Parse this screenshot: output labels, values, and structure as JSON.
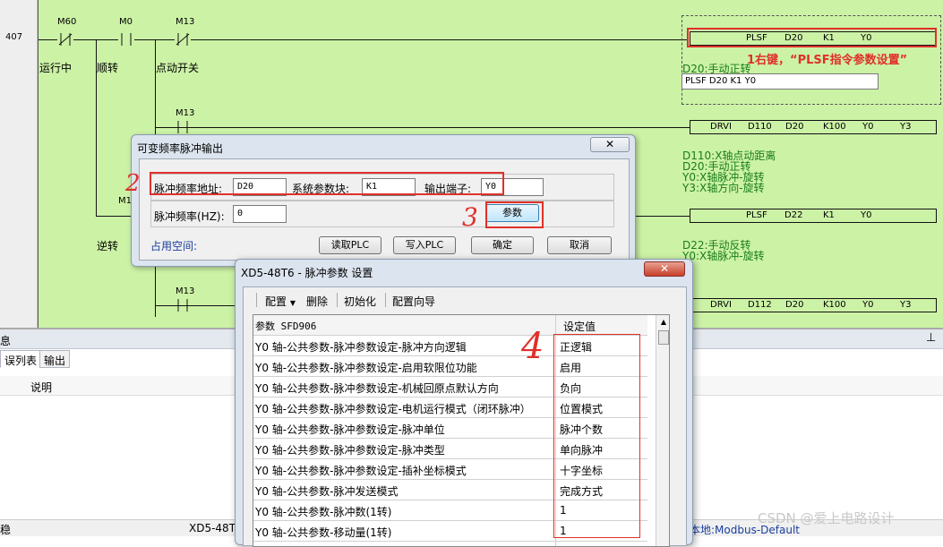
{
  "ladder": {
    "rung_number": "407",
    "contacts": {
      "m60": "M60",
      "m0": "M0",
      "m13_top": "M13",
      "m13_mid": "M13",
      "m1": "M1",
      "m13_bottom": "M13"
    },
    "labels": {
      "running": "运行中",
      "forward": "顺转",
      "jog_switch": "点动开关",
      "reverse": "逆转"
    },
    "instructions": {
      "plsf1": [
        "PLSF",
        "D20",
        "K1",
        "Y0"
      ],
      "drvi1": [
        "DRVI",
        "D110",
        "D20",
        "K100",
        "Y0",
        "Y3"
      ],
      "plsf2": [
        "PLSF",
        "D22",
        "K1",
        "Y0"
      ],
      "drvi2": [
        "DRVI",
        "D112",
        "D20",
        "K100",
        "Y0",
        "Y3"
      ]
    },
    "comments": {
      "c1": "D20:手动正转",
      "c2_l1": "D110:X轴点动距离",
      "c2_l2": "D20:手动正转",
      "c2_l3": "Y0:X轴脉冲-旋转",
      "c2_l4": "Y3:X轴方向-旋转",
      "c3_l1": "D22:手动反转",
      "c3_l2": "Y0:X轴脉冲-旋转"
    },
    "edit_field_value": "PLSF D20 K1 Y0"
  },
  "annotations": {
    "a1": "1右键，“PLSF指令参数设置”",
    "a2": "2",
    "a3": "3",
    "a4": "4"
  },
  "bottom_panel": {
    "title_fragment": "息",
    "pin_icon": "pin-icon",
    "tabs": [
      "误列表",
      "输出"
    ],
    "column_header": "说明",
    "status_left": "稳",
    "status_mid": "XD5-48T",
    "status_right": "本地:Modbus-Default"
  },
  "dialog1": {
    "title": "可变频率脉冲输出",
    "close_glyph": "✕",
    "freq_addr_label": "脉冲频率地址:",
    "freq_addr_value": "D20",
    "sys_param_label": "系统参数块:",
    "sys_param_value": "K1",
    "output_label": "输出端子:",
    "output_value": "Y0",
    "freq_label": "脉冲频率(HZ):",
    "freq_value": "0",
    "param_button": "参数",
    "occupied_label": "占用空间:",
    "read_plc": "读取PLC",
    "write_plc": "写入PLC",
    "ok": "确定",
    "cancel": "取消"
  },
  "dialog2": {
    "title": "XD5-48T6 - 脉冲参数 设置",
    "close_glyph": "✕",
    "toolbar": {
      "config": "配置",
      "delete": "删除",
      "init": "初始化",
      "wizard": "配置向导"
    },
    "header": {
      "param": "参数 SFD906",
      "value": "设定值"
    },
    "rows": [
      {
        "name": "Y0 轴-公共参数-脉冲参数设定-脉冲方向逻辑",
        "value": "正逻辑"
      },
      {
        "name": "Y0 轴-公共参数-脉冲参数设定-启用软限位功能",
        "value": "启用"
      },
      {
        "name": "Y0 轴-公共参数-脉冲参数设定-机械回原点默认方向",
        "value": "负向"
      },
      {
        "name": "Y0 轴-公共参数-脉冲参数设定-电机运行模式（闭环脉冲）",
        "value": "位置模式"
      },
      {
        "name": "Y0 轴-公共参数-脉冲参数设定-脉冲单位",
        "value": "脉冲个数"
      },
      {
        "name": "Y0 轴-公共参数-脉冲参数设定-脉冲类型",
        "value": "单向脉冲"
      },
      {
        "name": "Y0 轴-公共参数-脉冲参数设定-插补坐标模式",
        "value": "十字坐标"
      },
      {
        "name": "Y0 轴-公共参数-脉冲发送模式",
        "value": "完成方式"
      },
      {
        "name": "Y0 轴-公共参数-脉冲数(1转)",
        "value": "1"
      },
      {
        "name": "Y0 轴-公共参数-移动量(1转)",
        "value": "1"
      }
    ]
  },
  "watermark": "CSDN @爱上电路设计"
}
